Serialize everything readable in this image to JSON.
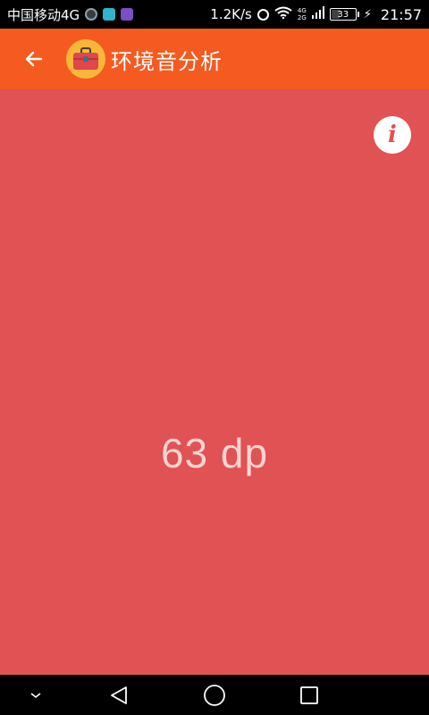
{
  "status_bar": {
    "carrier": "中国移动4G",
    "notification_icons": [
      "notification-icon",
      "cloud-app-icon",
      "gallery-icon"
    ],
    "net_speed": "1.2K/s",
    "network_types": [
      "4G",
      "2G"
    ],
    "battery_level": "33",
    "time": "21:57"
  },
  "app_bar": {
    "title": "环境音分析",
    "logo": "toolbox-icon",
    "back_icon": "arrow-left-icon"
  },
  "main": {
    "background_color": "#e05253",
    "info_label": "i",
    "reading": "63 dp"
  },
  "nav_bar": {
    "buttons": [
      "chevron-down-icon",
      "back-triangle-icon",
      "home-circle-icon",
      "recents-square-icon"
    ]
  },
  "colors": {
    "app_bar": "#f55a20",
    "main": "#e05253",
    "logo_bg": "#f8b73a"
  }
}
